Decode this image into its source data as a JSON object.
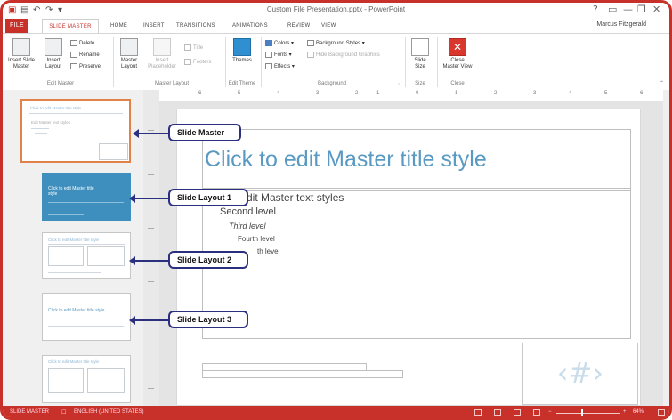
{
  "window": {
    "title": "Custom File Presentation.pptx - PowerPoint",
    "user": "Marcus Fitzgerald",
    "controls": [
      "?",
      "▭",
      "—",
      "❐",
      "✕"
    ]
  },
  "quick_access": {
    "save_icon": "save-icon",
    "undo_icon": "undo-icon",
    "redo_icon": "redo-icon"
  },
  "tabs": [
    "FILE",
    "SLIDE MASTER",
    "HOME",
    "INSERT",
    "TRANSITIONS",
    "ANIMATIONS",
    "REVIEW",
    "VIEW"
  ],
  "ribbon": {
    "edit_master": {
      "insert_slide_master": "Insert Slide Master",
      "insert_layout": "Insert Layout",
      "delete": "Delete",
      "rename": "Rename",
      "preserve": "Preserve",
      "label": "Edit Master"
    },
    "master_layout": {
      "master_layout": "Master Layout",
      "insert_placeholder": "Insert Placeholder",
      "title": "Title",
      "footers": "Footers",
      "label": "Master Layout"
    },
    "edit_theme": {
      "themes": "Themes",
      "label": "Edit Theme"
    },
    "background": {
      "colors": "Colors",
      "fonts": "Fonts",
      "effects": "Effects",
      "background_styles": "Background Styles",
      "hide_background_graphics": "Hide Background Graphics",
      "label": "Background"
    },
    "size": {
      "slide_size": "Slide Size",
      "label": "Size"
    },
    "close": {
      "close_master_view": "Close Master View",
      "label": "Close"
    }
  },
  "ruler": {
    "numbers": [
      "6",
      "5",
      "4",
      "3",
      "2",
      "1",
      "0",
      "1",
      "2",
      "3",
      "4",
      "5",
      "6"
    ]
  },
  "thumbnails": {
    "master": {
      "title": "Click to edit Master title style",
      "body": "Edit Master text styles"
    },
    "layout1": {
      "title": "Click to edit Master title style"
    },
    "layout2": {
      "title": "Click to edit Master title style"
    },
    "layout3": {
      "title": "Click to edit Master title style"
    },
    "layout4": {
      "title": "Click to edit Master title style"
    }
  },
  "slide": {
    "title": "Click to edit Master title style",
    "body_levels": [
      "dit Master text styles",
      "Second level",
      "Third level",
      "Fourth level",
      "th level"
    ],
    "number_placeholder": "‹#›"
  },
  "callouts": {
    "slide_master": "Slide Master",
    "slide_layout_1": "Slide Layout 1",
    "slide_layout_2": "Slide Layout 2",
    "slide_layout_3": "Slide Layout 3"
  },
  "status": {
    "view": "SLIDE MASTER",
    "language": "ENGLISH (UNITED STATES)",
    "zoom": "64%"
  },
  "colors": {
    "accent": "#c8312a",
    "title_blue": "#5a9ac2",
    "layout_fill": "#3e8fbd",
    "callout_border": "#2b2f80"
  }
}
